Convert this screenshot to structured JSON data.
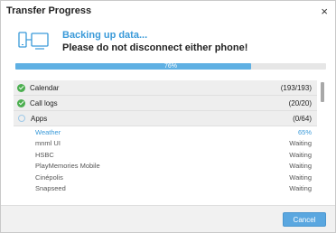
{
  "window": {
    "title": "Transfer Progress",
    "close_glyph": "×"
  },
  "status": {
    "main": "Backing up data...",
    "sub": "Please do not disconnect either phone!",
    "icon": "phones-transfer-icon"
  },
  "progress": {
    "percent": 76,
    "label": "76%"
  },
  "categories": [
    {
      "name": "Calendar",
      "count": "(193/193)",
      "state": "done"
    },
    {
      "name": "Call logs",
      "count": "(20/20)",
      "state": "done"
    },
    {
      "name": "Apps",
      "count": "(0/64)",
      "state": "pending"
    }
  ],
  "apps": [
    {
      "name": "Weather",
      "status": "65%",
      "active": true
    },
    {
      "name": "mnml UI",
      "status": "Waiting",
      "active": false
    },
    {
      "name": "HSBC",
      "status": "Waiting",
      "active": false
    },
    {
      "name": "PlayMemories Mobile",
      "status": "Waiting",
      "active": false
    },
    {
      "name": "Cinépolis",
      "status": "Waiting",
      "active": false
    },
    {
      "name": "Snapseed",
      "status": "Waiting",
      "active": false
    }
  ],
  "footer": {
    "cancel_label": "Cancel"
  },
  "colors": {
    "accent": "#3a9ad9",
    "progress_fill": "#5fb0e3",
    "check": "#4caf50",
    "button": "#5aa7e0"
  }
}
